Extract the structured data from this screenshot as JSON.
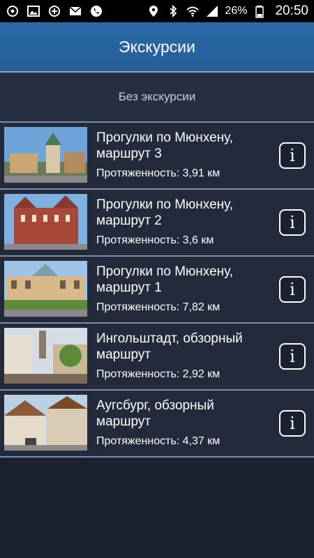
{
  "status_bar": {
    "battery": "26%",
    "time": "20:50",
    "icons_left": [
      "app-icon",
      "gallery-icon",
      "sync-icon",
      "mail-icon",
      "phone-icon"
    ],
    "icons_right": [
      "location-icon",
      "bluetooth-icon",
      "wifi-icon",
      "signal-icon",
      "battery-icon"
    ]
  },
  "header": {
    "title": "Экскурсии"
  },
  "no_tour": {
    "label": "Без экскурсии"
  },
  "tours": [
    {
      "title": "Прогулки по Мюнхену, маршрут 3",
      "length": "Протяженность: 3,91 км",
      "info": "i"
    },
    {
      "title": "Прогулки по Мюнхену, маршрут 2",
      "length": "Протяженность: 3,6 км",
      "info": "i"
    },
    {
      "title": "Прогулки по Мюнхену, маршрут 1",
      "length": "Протяженность: 7,82 км",
      "info": "i"
    },
    {
      "title": "Ингольштадт, обзорный маршрут",
      "length": "Протяженность: 2,92 км",
      "info": "i"
    },
    {
      "title": "Аугсбург, обзорный маршрут",
      "length": "Протяженность: 4,37 км",
      "info": "i"
    }
  ],
  "colors": {
    "header": "#2a6aa7",
    "background": "#1b2130",
    "row": "#232a3c",
    "divider": "#7f8ca6"
  }
}
